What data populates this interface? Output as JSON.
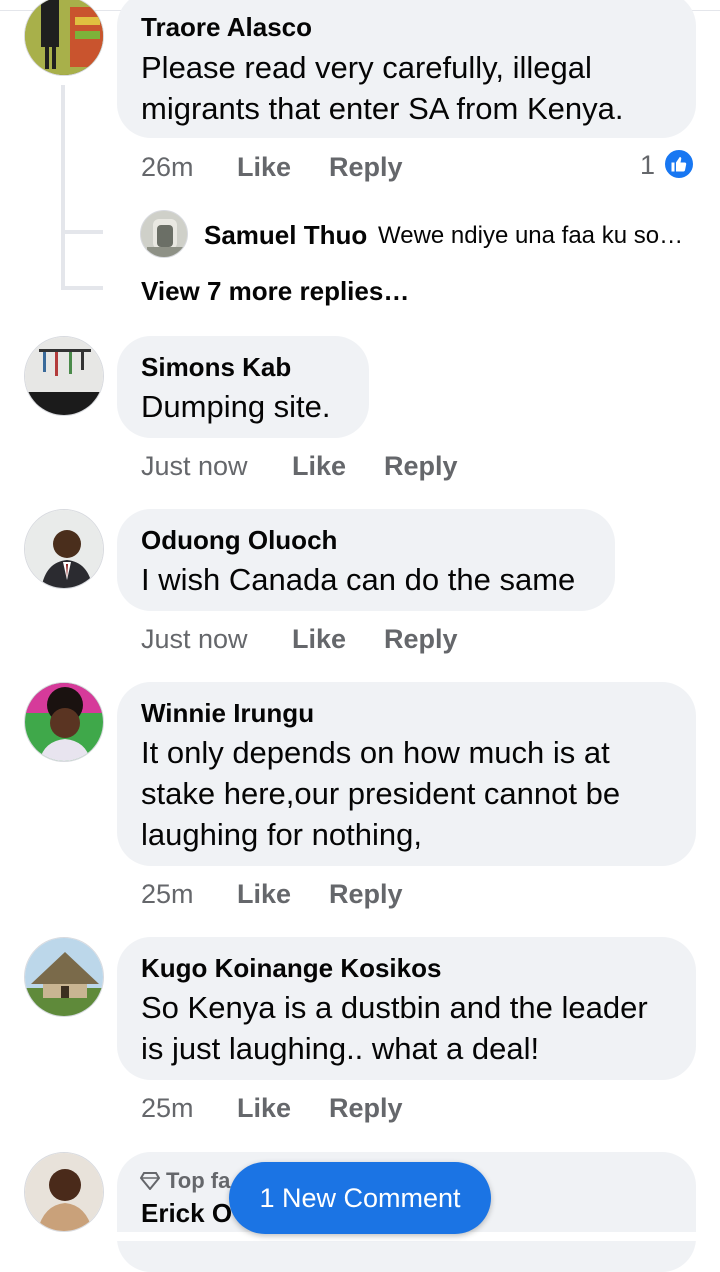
{
  "comments": [
    {
      "name": "Traore Alasco",
      "lines": [
        "Please read very carefully, illegal",
        "migrants that enter SA from Kenya."
      ],
      "time": "26m",
      "like": "Like",
      "reply": "Reply",
      "reaction_count": "1"
    },
    {
      "name": "Simons Kab",
      "lines": [
        "Dumping site."
      ],
      "time": "Just now",
      "like": "Like",
      "reply": "Reply"
    },
    {
      "name": "Oduong Oluoch",
      "lines": [
        "I wish Canada can do the same"
      ],
      "time": "Just now",
      "like": "Like",
      "reply": "Reply"
    },
    {
      "name": "Winnie Irungu",
      "lines": [
        "It only depends on how much is at",
        "stake here,our president cannot be",
        "laughing for nothing,"
      ],
      "time": "25m",
      "like": "Like",
      "reply": "Reply"
    },
    {
      "name": "Kugo Koinange Kosikos",
      "lines": [
        "So Kenya is a dustbin and the leader",
        "is just laughing.. what a deal!"
      ],
      "time": "25m",
      "like": "Like",
      "reply": "Reply"
    },
    {
      "name": "Erick O",
      "badge": "Top fa",
      "lines": []
    }
  ],
  "reply_preview": {
    "name": "Samuel Thuo",
    "text": "Wewe ndiye una faa ku so…"
  },
  "view_more": "View 7 more replies…",
  "new_comment_toast": "1 New Comment",
  "icons": {
    "like_reaction": "thumbs-up-icon",
    "top_fan": "diamond-icon"
  },
  "colors": {
    "accent": "#1877f2",
    "bubble": "#f0f2f5",
    "meta_text": "#65676b"
  }
}
